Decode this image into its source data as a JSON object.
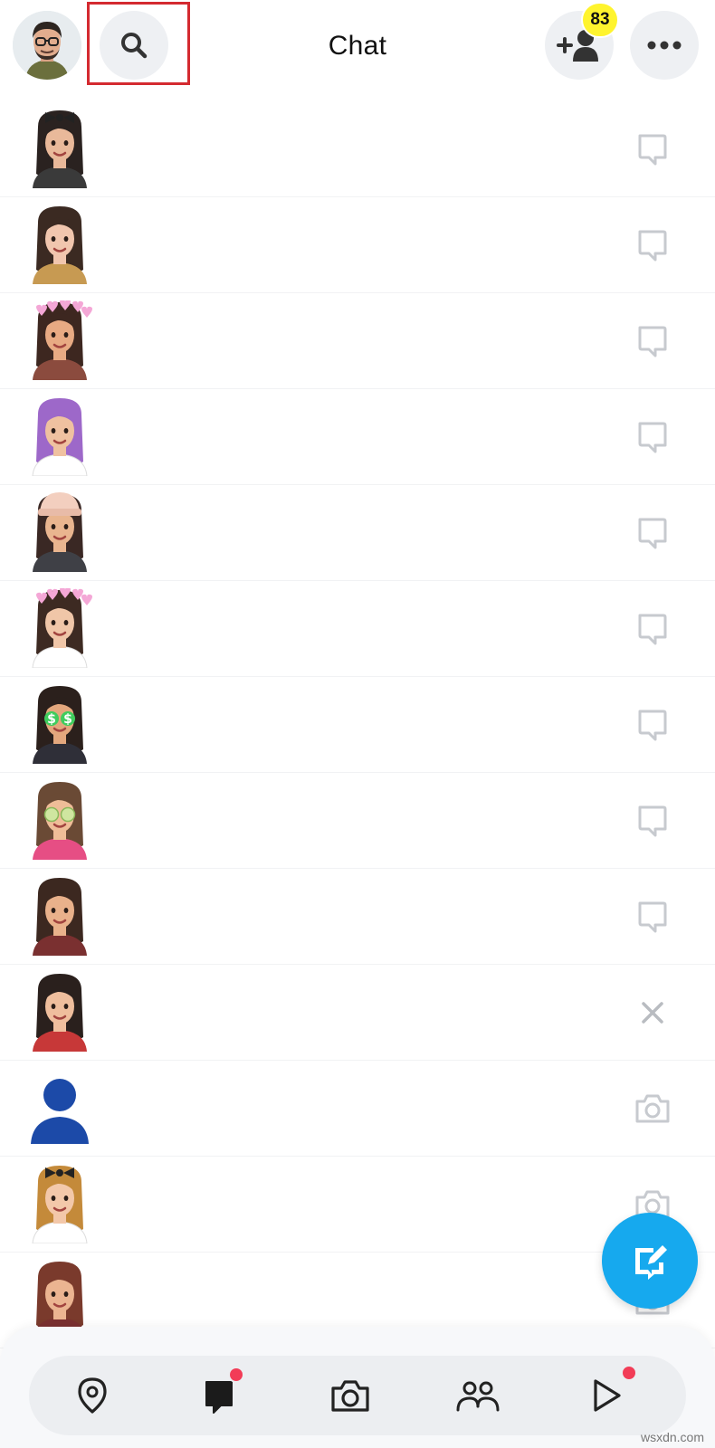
{
  "header": {
    "title": "Chat",
    "profile_icon": "bitmoji-avatar",
    "search_icon": "search-icon",
    "add_friend_icon": "add-friend-icon",
    "friend_requests_count": "83",
    "more_icon": "more-icon"
  },
  "chats": [
    {
      "avatar_hair": "#2a2220",
      "skin": "#e9b99a",
      "shirt": "#3a3a3a",
      "accessory": "bow",
      "action": "chat-bubble-icon"
    },
    {
      "avatar_hair": "#3b2a22",
      "skin": "#f1c6ae",
      "shirt": "#c79a52",
      "accessory": "none",
      "action": "chat-bubble-icon"
    },
    {
      "avatar_hair": "#3d2720",
      "skin": "#e8aa83",
      "shirt": "#8b4b3e",
      "accessory": "hearts",
      "action": "chat-bubble-icon"
    },
    {
      "avatar_hair": "#9d68c9",
      "skin": "#efc1a0",
      "shirt": "#ffffff",
      "accessory": "none",
      "action": "chat-bubble-icon"
    },
    {
      "avatar_hair": "#3a2824",
      "skin": "#e9b58f",
      "shirt": "#3f4046",
      "accessory": "beanie",
      "action": "chat-bubble-icon"
    },
    {
      "avatar_hair": "#3d2a22",
      "skin": "#f0c6a8",
      "shirt": "#ffffff",
      "accessory": "hearts",
      "action": "chat-bubble-icon"
    },
    {
      "avatar_hair": "#2b201c",
      "skin": "#e3a77d",
      "shirt": "#2f2f38",
      "accessory": "dollar-eyes",
      "action": "chat-bubble-icon"
    },
    {
      "avatar_hair": "#6a4a35",
      "skin": "#efbd98",
      "shirt": "#e64e84",
      "accessory": "cucumber-eyes",
      "action": "chat-bubble-icon"
    },
    {
      "avatar_hair": "#3c2820",
      "skin": "#e9b18b",
      "shirt": "#7a3030",
      "accessory": "none",
      "action": "chat-bubble-icon"
    },
    {
      "avatar_hair": "#2a201d",
      "skin": "#efbe9d",
      "shirt": "#c73838",
      "accessory": "none",
      "action": "close-icon"
    },
    {
      "avatar_hair": "#1c4aa8",
      "skin": "#1c4aa8",
      "shirt": "#1c4aa8",
      "accessory": "silhouette",
      "action": "camera-icon"
    },
    {
      "avatar_hair": "#c48a3a",
      "skin": "#f3c8aa",
      "shirt": "#ffffff",
      "accessory": "bow",
      "action": "camera-icon"
    },
    {
      "avatar_hair": "#7a3a2c",
      "skin": "#ebb491",
      "shirt": "#7a3030",
      "accessory": "none",
      "action": "camera-icon"
    }
  ],
  "fab": {
    "icon": "new-chat-icon",
    "color": "#16a9ee"
  },
  "bottom_nav": [
    {
      "name": "map",
      "icon": "map-pin-icon",
      "notification": false
    },
    {
      "name": "chat",
      "icon": "chat-icon",
      "notification": true
    },
    {
      "name": "camera",
      "icon": "camera-icon",
      "notification": false
    },
    {
      "name": "stories",
      "icon": "friends-icon",
      "notification": false
    },
    {
      "name": "spotlight",
      "icon": "play-icon",
      "notification": true
    }
  ],
  "watermark": "wsxdn.com",
  "colors": {
    "accent": "#16a9ee",
    "badge": "#fff42e",
    "notification": "#f23c57",
    "highlight": "#d42a30"
  }
}
